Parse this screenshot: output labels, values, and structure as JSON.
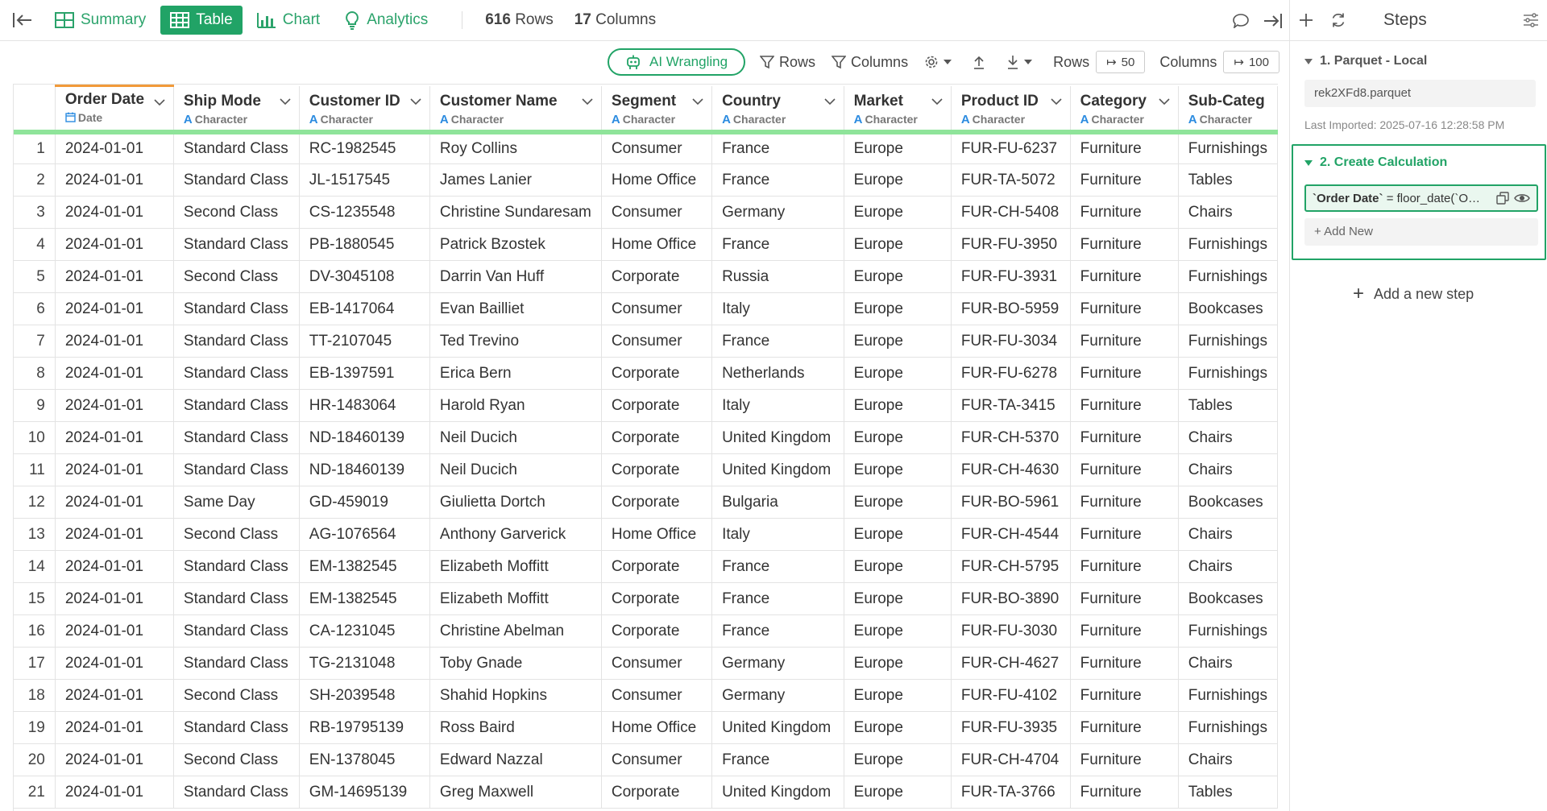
{
  "topbar": {
    "tabs": [
      {
        "label": "Summary",
        "icon": "summary-icon"
      },
      {
        "label": "Table",
        "icon": "table-icon"
      },
      {
        "label": "Chart",
        "icon": "bar-chart-icon"
      },
      {
        "label": "Analytics",
        "icon": "lightbulb-icon"
      }
    ],
    "active_tab": "Table",
    "rows_count": "616",
    "rows_label": "Rows",
    "cols_count": "17",
    "cols_label": "Columns"
  },
  "toolbar": {
    "ai_label": "AI Wrangling",
    "rows_filter_label": "Rows",
    "columns_filter_label": "Columns",
    "rows_label": "Rows",
    "rows_value": "50",
    "columns_label": "Columns",
    "columns_value": "100"
  },
  "table": {
    "columns": [
      {
        "name": "Order Date",
        "type": "Date"
      },
      {
        "name": "Ship Mode",
        "type": "Character"
      },
      {
        "name": "Customer ID",
        "type": "Character"
      },
      {
        "name": "Customer Name",
        "type": "Character"
      },
      {
        "name": "Segment",
        "type": "Character"
      },
      {
        "name": "Country",
        "type": "Character"
      },
      {
        "name": "Market",
        "type": "Character"
      },
      {
        "name": "Product ID",
        "type": "Character"
      },
      {
        "name": "Category",
        "type": "Character"
      },
      {
        "name": "Sub-Categ",
        "type": "Character"
      }
    ],
    "rows": [
      [
        "1",
        "2024-01-01",
        "Standard Class",
        "RC-1982545",
        "Roy Collins",
        "Consumer",
        "France",
        "Europe",
        "FUR-FU-6237",
        "Furniture",
        "Furnishings"
      ],
      [
        "2",
        "2024-01-01",
        "Standard Class",
        "JL-1517545",
        "James Lanier",
        "Home Office",
        "France",
        "Europe",
        "FUR-TA-5072",
        "Furniture",
        "Tables"
      ],
      [
        "3",
        "2024-01-01",
        "Second Class",
        "CS-1235548",
        "Christine Sundaresam",
        "Consumer",
        "Germany",
        "Europe",
        "FUR-CH-5408",
        "Furniture",
        "Chairs"
      ],
      [
        "4",
        "2024-01-01",
        "Standard Class",
        "PB-1880545",
        "Patrick Bzostek",
        "Home Office",
        "France",
        "Europe",
        "FUR-FU-3950",
        "Furniture",
        "Furnishings"
      ],
      [
        "5",
        "2024-01-01",
        "Second Class",
        "DV-3045108",
        "Darrin Van Huff",
        "Corporate",
        "Russia",
        "Europe",
        "FUR-FU-3931",
        "Furniture",
        "Furnishings"
      ],
      [
        "6",
        "2024-01-01",
        "Standard Class",
        "EB-1417064",
        "Evan Bailliet",
        "Consumer",
        "Italy",
        "Europe",
        "FUR-BO-5959",
        "Furniture",
        "Bookcases"
      ],
      [
        "7",
        "2024-01-01",
        "Standard Class",
        "TT-2107045",
        "Ted Trevino",
        "Consumer",
        "France",
        "Europe",
        "FUR-FU-3034",
        "Furniture",
        "Furnishings"
      ],
      [
        "8",
        "2024-01-01",
        "Standard Class",
        "EB-1397591",
        "Erica Bern",
        "Corporate",
        "Netherlands",
        "Europe",
        "FUR-FU-6278",
        "Furniture",
        "Furnishings"
      ],
      [
        "9",
        "2024-01-01",
        "Standard Class",
        "HR-1483064",
        "Harold Ryan",
        "Corporate",
        "Italy",
        "Europe",
        "FUR-TA-3415",
        "Furniture",
        "Tables"
      ],
      [
        "10",
        "2024-01-01",
        "Standard Class",
        "ND-18460139",
        "Neil Ducich",
        "Corporate",
        "United Kingdom",
        "Europe",
        "FUR-CH-5370",
        "Furniture",
        "Chairs"
      ],
      [
        "11",
        "2024-01-01",
        "Standard Class",
        "ND-18460139",
        "Neil Ducich",
        "Corporate",
        "United Kingdom",
        "Europe",
        "FUR-CH-4630",
        "Furniture",
        "Chairs"
      ],
      [
        "12",
        "2024-01-01",
        "Same Day",
        "GD-459019",
        "Giulietta Dortch",
        "Corporate",
        "Bulgaria",
        "Europe",
        "FUR-BO-5961",
        "Furniture",
        "Bookcases"
      ],
      [
        "13",
        "2024-01-01",
        "Second Class",
        "AG-1076564",
        "Anthony Garverick",
        "Home Office",
        "Italy",
        "Europe",
        "FUR-CH-4544",
        "Furniture",
        "Chairs"
      ],
      [
        "14",
        "2024-01-01",
        "Standard Class",
        "EM-1382545",
        "Elizabeth Moffitt",
        "Corporate",
        "France",
        "Europe",
        "FUR-CH-5795",
        "Furniture",
        "Chairs"
      ],
      [
        "15",
        "2024-01-01",
        "Standard Class",
        "EM-1382545",
        "Elizabeth Moffitt",
        "Corporate",
        "France",
        "Europe",
        "FUR-BO-3890",
        "Furniture",
        "Bookcases"
      ],
      [
        "16",
        "2024-01-01",
        "Standard Class",
        "CA-1231045",
        "Christine Abelman",
        "Corporate",
        "France",
        "Europe",
        "FUR-FU-3030",
        "Furniture",
        "Furnishings"
      ],
      [
        "17",
        "2024-01-01",
        "Standard Class",
        "TG-2131048",
        "Toby Gnade",
        "Consumer",
        "Germany",
        "Europe",
        "FUR-CH-4627",
        "Furniture",
        "Chairs"
      ],
      [
        "18",
        "2024-01-01",
        "Second Class",
        "SH-2039548",
        "Shahid Hopkins",
        "Consumer",
        "Germany",
        "Europe",
        "FUR-FU-4102",
        "Furniture",
        "Furnishings"
      ],
      [
        "19",
        "2024-01-01",
        "Standard Class",
        "RB-19795139",
        "Ross Baird",
        "Home Office",
        "United Kingdom",
        "Europe",
        "FUR-FU-3935",
        "Furniture",
        "Furnishings"
      ],
      [
        "20",
        "2024-01-01",
        "Second Class",
        "EN-1378045",
        "Edward Nazzal",
        "Consumer",
        "France",
        "Europe",
        "FUR-CH-4704",
        "Furniture",
        "Chairs"
      ],
      [
        "21",
        "2024-01-01",
        "Standard Class",
        "GM-14695139",
        "Greg Maxwell",
        "Corporate",
        "United Kingdom",
        "Europe",
        "FUR-TA-3766",
        "Furniture",
        "Tables"
      ]
    ]
  },
  "steps_panel": {
    "title": "Steps",
    "step1": {
      "title": "1. Parquet - Local",
      "source": "rek2XFd8.parquet",
      "last_imported": "Last Imported: 2025-07-16 12:28:58 PM"
    },
    "step2": {
      "title": "2. Create Calculation",
      "calc_name": "`Order Date`",
      "calc_expr": " = floor_date(`O…"
    },
    "add_new": "+ Add New",
    "add_step": "Add a new step"
  },
  "colors": {
    "accent": "#21a366",
    "header_underline": "#8fe49a",
    "sorted_col_top": "#f19a3a",
    "type_glyph": "#2b8be0"
  }
}
